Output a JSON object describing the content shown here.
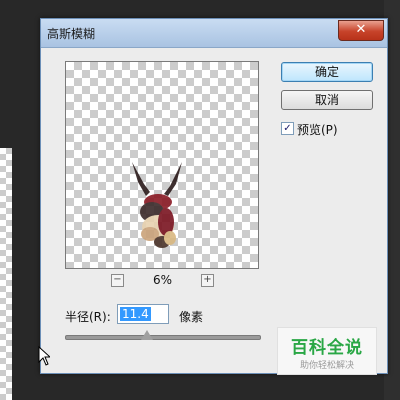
{
  "dialog": {
    "title": "高斯模糊",
    "close_glyph": "✕"
  },
  "buttons": {
    "ok_label": "确定",
    "cancel_label": "取消"
  },
  "preview_option": {
    "label": "预览(P)",
    "checked": true,
    "check_glyph": "✓"
  },
  "zoom": {
    "minus_glyph": "−",
    "plus_glyph": "+",
    "level": "6%"
  },
  "radius": {
    "label": "半径(R):",
    "value": "11.4",
    "unit": "像素"
  },
  "slider": {
    "level_fraction": 0.42
  },
  "watermark": {
    "title": "百科全说",
    "subtitle": "助你轻松解决"
  },
  "colors": {
    "accent": "#3399ff",
    "titlebar": "#b8cfe9",
    "close_button": "#c7432a",
    "watermark_green": "#29a745"
  }
}
